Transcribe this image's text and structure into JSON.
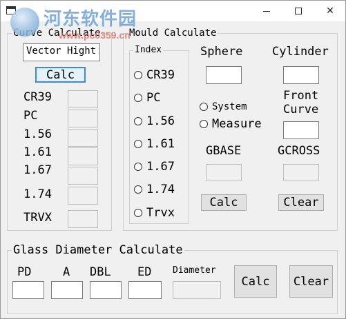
{
  "window": {
    "controls": {
      "minimize": "—",
      "maximize": "☐",
      "close": "✕"
    }
  },
  "watermark": {
    "title": "河东软件园",
    "url": "www.pc0359.cn"
  },
  "curve_calc": {
    "legend": "Curve Calculate",
    "select_value": "Vector Hight",
    "calc_label": "Calc",
    "rows": [
      "CR39",
      "PC",
      "1.56",
      "1.61",
      "1.67",
      "1.74",
      "TRVX"
    ]
  },
  "mould_calc": {
    "legend": "Mould Calculate",
    "index_legend": "Index",
    "radios": [
      "CR39",
      "PC",
      "1.56",
      "1.61",
      "1.67",
      "1.74",
      "Trvx"
    ],
    "sphere_label": "Sphere",
    "cylinder_label": "Cylinder",
    "system_label": "System",
    "measure_label": "Measure",
    "front_curve_line1": "Front",
    "front_curve_line2": "Curve",
    "gbase_label": "GBASE",
    "gcross_label": "GCROSS",
    "calc_label": "Calc",
    "clear_label": "Clear"
  },
  "glass_diameter": {
    "legend": "Glass Diameter Calculate",
    "pd_label": "PD",
    "a_label": "A",
    "dbl_label": "DBL",
    "ed_label": "ED",
    "diameter_label": "Diameter",
    "calc_label": "Calc",
    "clear_label": "Clear"
  }
}
